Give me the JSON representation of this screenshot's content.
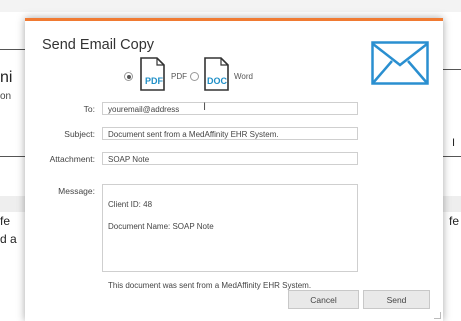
{
  "background": {
    "left_fragment": "ni",
    "left_small_fragment": "on",
    "left_lines": [
      "fe",
      "d a"
    ],
    "right_fragment": "fe",
    "right_box_char": "I"
  },
  "dialog": {
    "title": "Send Email Copy",
    "accent_color": "#f07a32",
    "format_options": [
      {
        "icon": "pdf-file-icon",
        "icon_text": "PDF",
        "label": "PDF",
        "selected": true
      },
      {
        "icon": "doc-file-icon",
        "icon_text": "DOC",
        "label": "Word",
        "selected": false
      }
    ],
    "envelope_icon": "envelope-icon",
    "fields": {
      "to": {
        "label": "To:",
        "value": "youremail@address"
      },
      "subject": {
        "label": "Subject:",
        "value": "Document sent from a MedAffinity EHR System."
      },
      "attachment": {
        "label": "Attachment:",
        "value": "SOAP Note"
      },
      "message": {
        "label": "Message:",
        "line1": "Client ID: 48",
        "line2": "Document Name: SOAP Note",
        "line3": "This document was sent from a MedAffinity EHR System."
      }
    },
    "buttons": {
      "cancel": "Cancel",
      "send": "Send"
    }
  }
}
